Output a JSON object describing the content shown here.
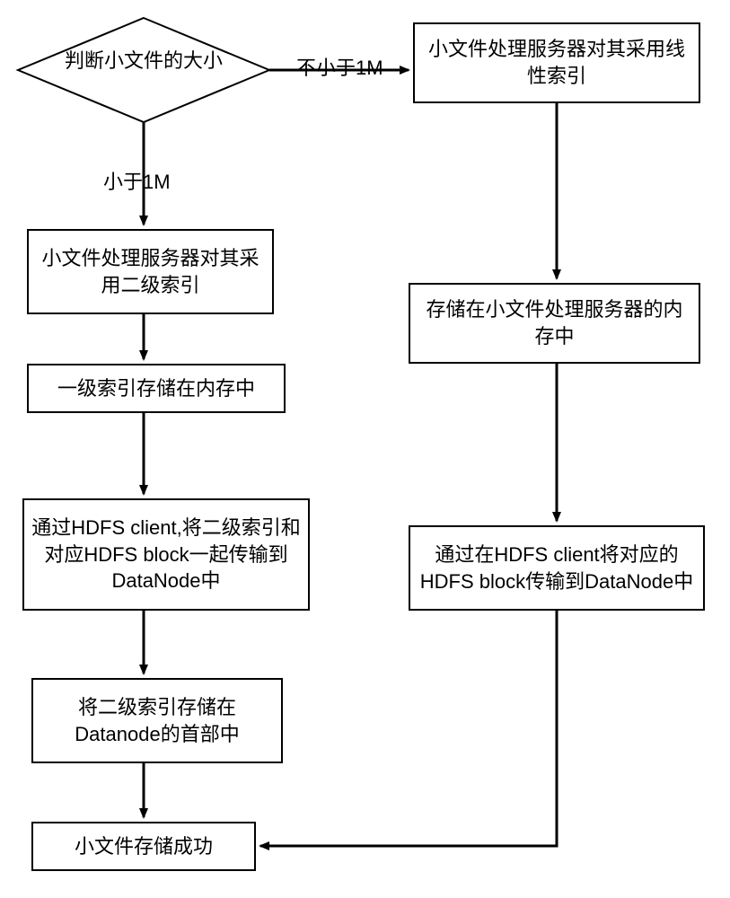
{
  "chart_data": {
    "type": "flowchart",
    "nodes": [
      {
        "id": "d1",
        "shape": "decision",
        "text": "判断小文件的大小"
      },
      {
        "id": "b_r1",
        "shape": "process",
        "text": "小文件处理服务器对其采用线性索引"
      },
      {
        "id": "b_l1",
        "shape": "process",
        "text": "小文件处理服务器对其采用二级索引"
      },
      {
        "id": "b_l2",
        "shape": "process",
        "text": "一级索引存储在内存中"
      },
      {
        "id": "b_r2",
        "shape": "process",
        "text": "存储在小文件处理服务器的内存中"
      },
      {
        "id": "b_l3",
        "shape": "process",
        "text": "通过HDFS client,将二级索引和对应HDFS block一起传输到DataNode中"
      },
      {
        "id": "b_r3",
        "shape": "process",
        "text": "通过在HDFS client将对应的HDFS  block传输到DataNode中"
      },
      {
        "id": "b_l4",
        "shape": "process",
        "text": "将二级索引存储在Datanode的首部中"
      },
      {
        "id": "b_end",
        "shape": "process",
        "text": "小文件存储成功"
      }
    ],
    "edges": [
      {
        "from": "d1",
        "to": "b_r1",
        "label": "不小于1M"
      },
      {
        "from": "d1",
        "to": "b_l1",
        "label": "小于1M"
      },
      {
        "from": "b_l1",
        "to": "b_l2",
        "label": ""
      },
      {
        "from": "b_l2",
        "to": "b_l3",
        "label": ""
      },
      {
        "from": "b_l3",
        "to": "b_l4",
        "label": ""
      },
      {
        "from": "b_l4",
        "to": "b_end",
        "label": ""
      },
      {
        "from": "b_r1",
        "to": "b_r2",
        "label": ""
      },
      {
        "from": "b_r2",
        "to": "b_r3",
        "label": ""
      },
      {
        "from": "b_r3",
        "to": "b_end",
        "label": ""
      }
    ]
  },
  "labels": {
    "edge_ge_1m": "不小于1M",
    "edge_lt_1m": "小于1M"
  }
}
